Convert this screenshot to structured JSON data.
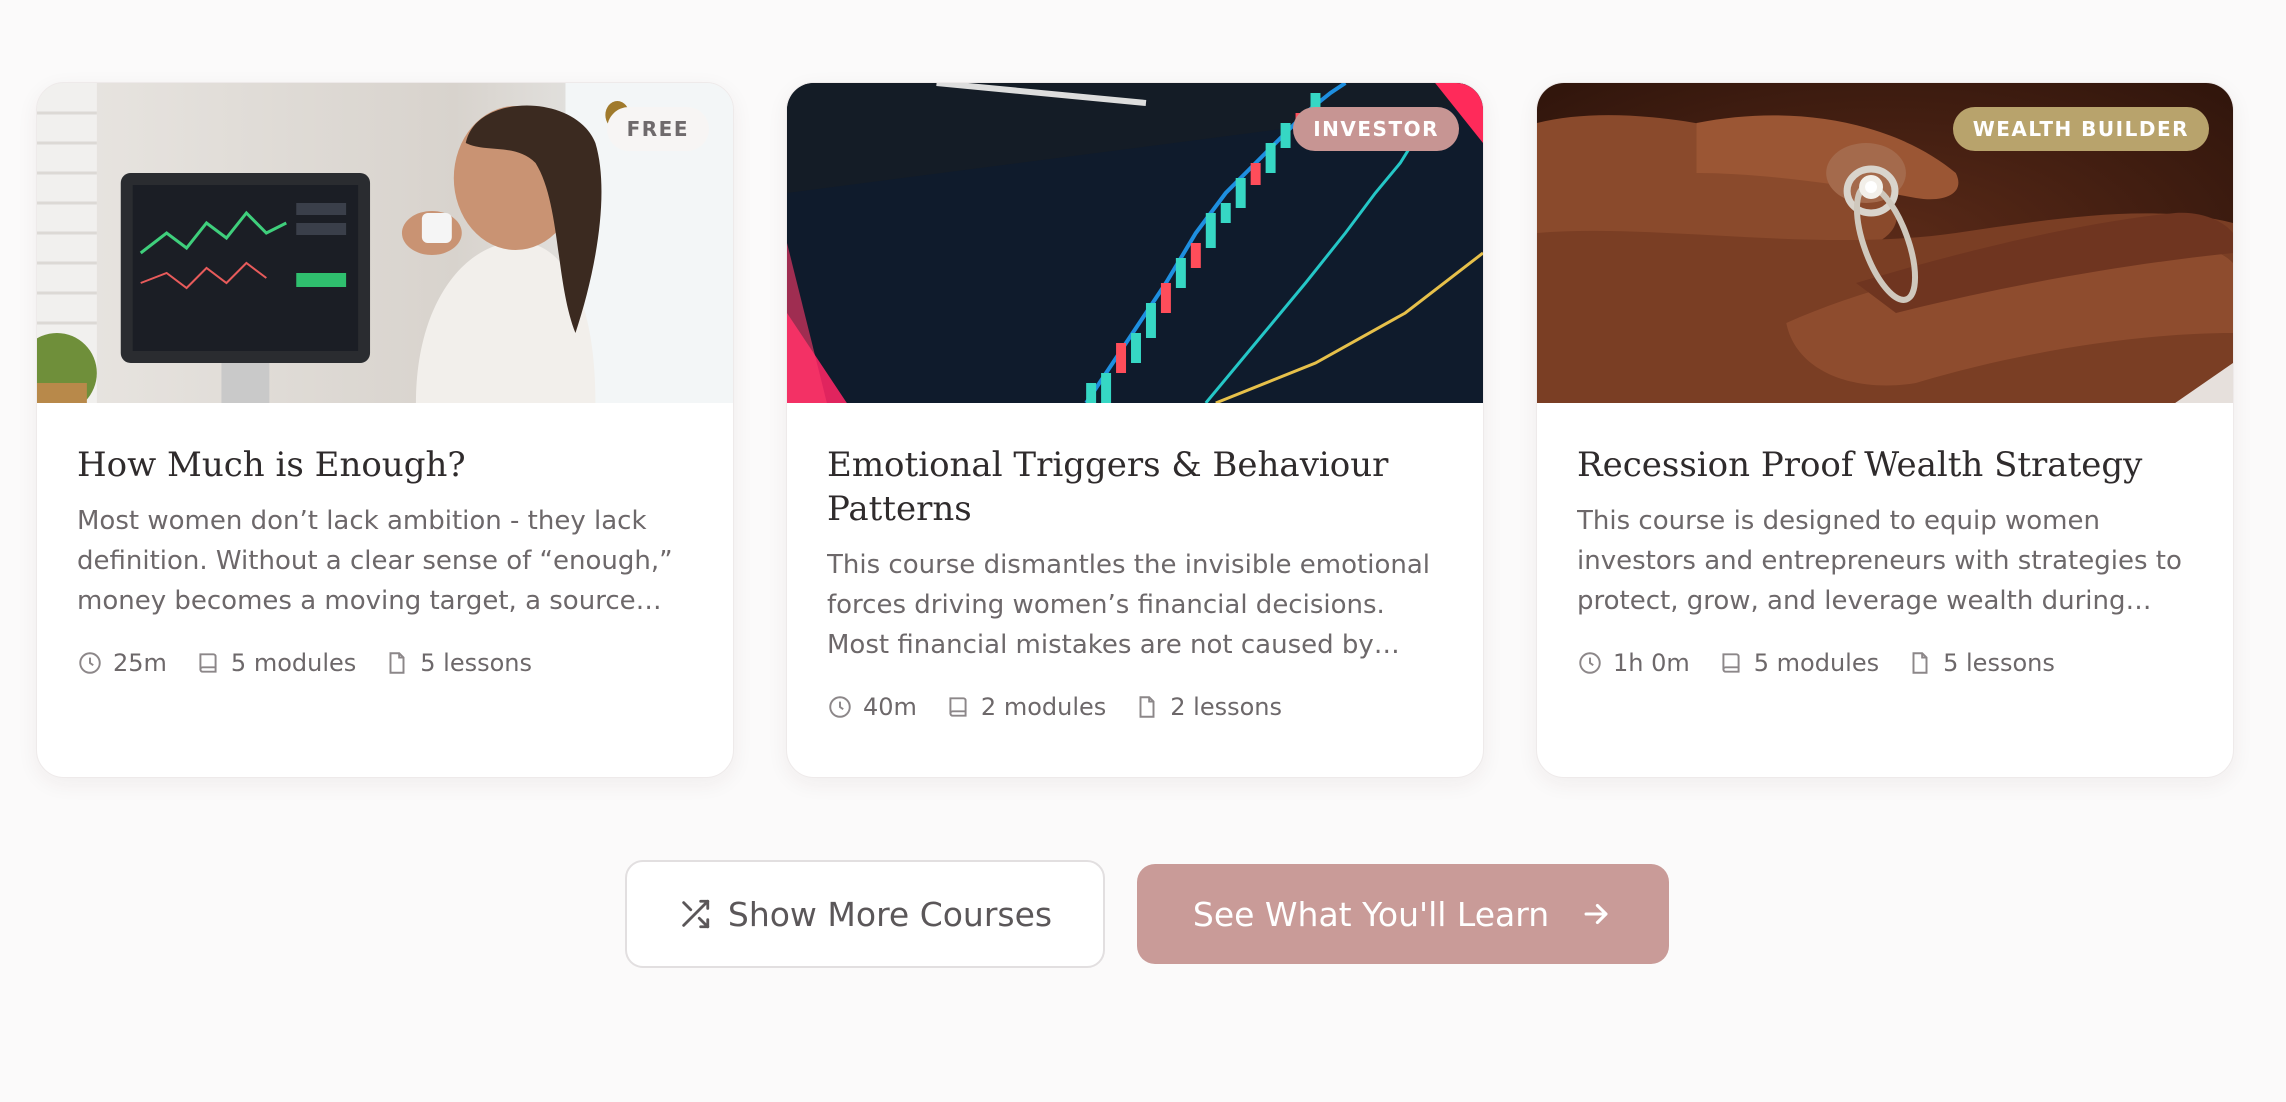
{
  "courses": [
    {
      "badge": "FREE",
      "title": "How Much is Enough?",
      "description": "Most women don’t lack ambition - they lack definition. Without a clear sense of “enough,” money becomes a moving target, a source of…",
      "duration": "25m",
      "modules": "5 modules",
      "lessons": "5 lessons",
      "image": "woman-trading-at-computer"
    },
    {
      "badge": "INVESTOR",
      "title": "Emotional Triggers & Behaviour Patterns",
      "description": "This course dismantles the invisible emotional forces driving women’s financial decisions. Most financial mistakes are not caused by lac…",
      "duration": "40m",
      "modules": "2 modules",
      "lessons": "2 lessons",
      "image": "candlestick-stock-chart"
    },
    {
      "badge": "WEALTH BUILDER",
      "title": "Recession Proof Wealth Strategy",
      "description": "This course is designed to equip women investors and entrepreneurs with strategies to protect, grow, and leverage wealth during…",
      "duration": "1h 0m",
      "modules": "5 modules",
      "lessons": "5 lessons",
      "image": "hands-with-diamond-ring"
    }
  ],
  "actions": {
    "show_more": "Show More Courses",
    "see_learn": "See What You'll Learn"
  },
  "icons": {
    "duration": "clock-icon",
    "modules": "book-icon",
    "lessons": "file-icon",
    "show_more": "shuffle-icon",
    "see_learn": "arrow-right-icon"
  },
  "colors": {
    "badge_free_bg": "#f7f5f4",
    "badge_investor_bg": "#c79593",
    "badge_wealth_bg": "#b8a36c",
    "primary_button": "#c99b98"
  }
}
